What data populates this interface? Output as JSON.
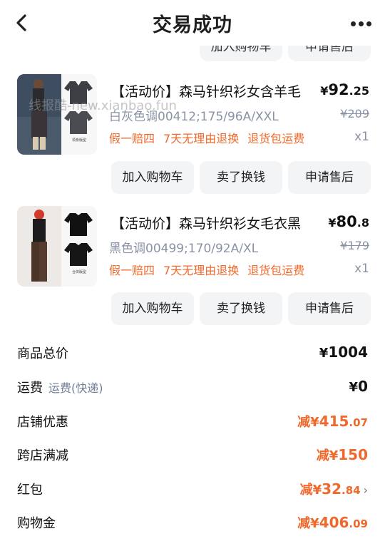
{
  "header": {
    "title": "交易成功"
  },
  "watermark": "线报酷-new.xianbao.fun",
  "previous_actions": [
    "加入购物车",
    "申请售后"
  ],
  "items": [
    {
      "title": "【活动价】森马针织衫女含羊毛",
      "price_currency": "¥",
      "price_int": "92",
      "price_dec": ".25",
      "spec": "白灰色调00412;175/96A/XXL",
      "original_price": "¥209",
      "promos": [
        "假一赔四",
        "7天无理由退换",
        "退货包运费"
      ],
      "qty": "x1",
      "thumb_tag": "领身版型",
      "buttons": [
        "加入购物车",
        "卖了换钱",
        "申请售后"
      ]
    },
    {
      "title": "【活动价】森马针织衫女毛衣黑",
      "price_currency": "¥",
      "price_int": "80",
      "price_dec": ".8",
      "spec": "黑色调00499;170/92A/XL",
      "original_price": "¥179",
      "promos": [
        "假一赔四",
        "7天无理由退换",
        "退货包运费"
      ],
      "qty": "x1",
      "thumb_tag": "合体版型",
      "buttons": [
        "加入购物车",
        "卖了换钱",
        "申请售后"
      ]
    }
  ],
  "summary": [
    {
      "label": "商品总价",
      "sub": "",
      "prefix": "",
      "currency": "¥",
      "int": "1004",
      "dec": "",
      "orange": false,
      "chevron": false
    },
    {
      "label": "运费",
      "sub": "运费(快递)",
      "prefix": "",
      "currency": "¥",
      "int": "0",
      "dec": "",
      "orange": false,
      "chevron": false
    },
    {
      "label": "店铺优惠",
      "sub": "",
      "prefix": "减",
      "currency": "¥",
      "int": "415",
      "dec": ".07",
      "orange": true,
      "chevron": false
    },
    {
      "label": "跨店满减",
      "sub": "",
      "prefix": "减",
      "currency": "¥",
      "int": "150",
      "dec": "",
      "orange": true,
      "chevron": false
    },
    {
      "label": "红包",
      "sub": "",
      "prefix": "减",
      "currency": "¥",
      "int": "32",
      "dec": ".84",
      "orange": true,
      "chevron": true
    },
    {
      "label": "购物金",
      "sub": "",
      "prefix": "减",
      "currency": "¥",
      "int": "406",
      "dec": ".09",
      "orange": true,
      "chevron": false
    }
  ],
  "colors": {
    "accent": "#f0682a",
    "muted": "#8a93a6",
    "button_bg": "#f3f4f6"
  },
  "icons": {
    "back": "chevron-left-icon",
    "more": "more-dots-icon",
    "row_chevron": "chevron-right-icon"
  }
}
